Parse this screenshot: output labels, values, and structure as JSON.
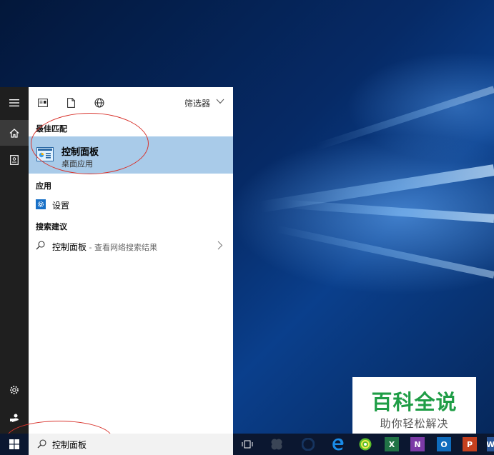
{
  "start_menu": {
    "filter_label": "筛选器",
    "sections": {
      "best_match": "最佳匹配",
      "apps": "应用",
      "suggestions": "搜索建议"
    },
    "best_match_item": {
      "title": "控制面板",
      "subtitle": "桌面应用"
    },
    "app_item": {
      "label": "设置"
    },
    "suggestion_item": {
      "query": "控制面板",
      "hint": " - 查看网络搜索结果"
    }
  },
  "taskbar": {
    "search_text": "控制面板",
    "apps": [
      "task-view",
      "store",
      "edge-disabled",
      "edge",
      "360-browser",
      "excel",
      "onenote",
      "outlook",
      "powerpoint",
      "word"
    ]
  },
  "watermark": {
    "main": "百科全说",
    "sub": "助你轻松解决"
  },
  "colors": {
    "highlight": "#a9cbe9",
    "rail": "#1f1f1f",
    "accent": "#1870c7",
    "annotation": "#d8332c",
    "watermark_green": "#1f9d46"
  }
}
